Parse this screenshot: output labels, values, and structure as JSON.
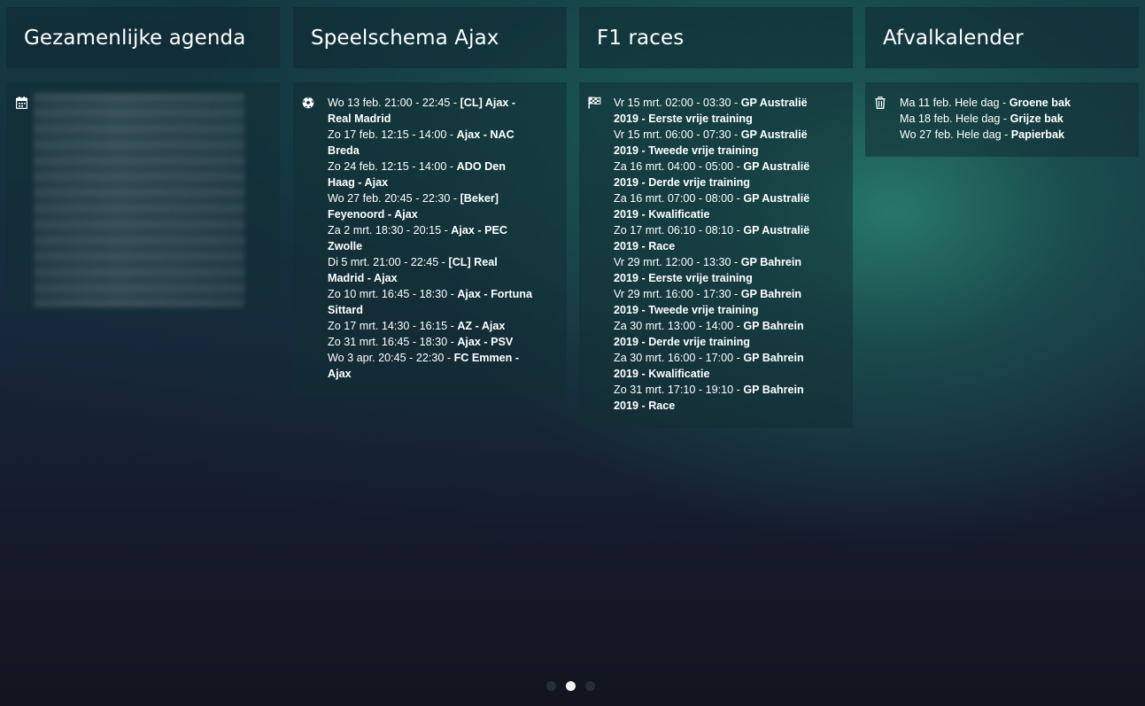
{
  "columns": [
    {
      "title": "Gezamenlijke agenda",
      "icon": "calendar-icon",
      "content": "blurred",
      "events": []
    },
    {
      "title": "Speelschema Ajax",
      "icon": "soccer-ball-icon",
      "events": [
        {
          "time": "Wo 13 feb. 21:00 - 22:45 - ",
          "title": "[CL] Ajax - Real Madrid"
        },
        {
          "time": "Zo 17 feb. 12:15 - 14:00 - ",
          "title": "Ajax - NAC Breda"
        },
        {
          "time": "Zo 24 feb. 12:15 - 14:00 - ",
          "title": "ADO Den Haag - Ajax"
        },
        {
          "time": "Wo 27 feb. 20:45 - 22:30 - ",
          "title": "[Beker] Feyenoord - Ajax"
        },
        {
          "time": "Za 2 mrt. 18:30 - 20:15 - ",
          "title": "Ajax - PEC Zwolle"
        },
        {
          "time": "Di 5 mrt. 21:00 - 22:45 - ",
          "title": "[CL] Real Madrid - Ajax"
        },
        {
          "time": "Zo 10 mrt. 16:45 - 18:30 - ",
          "title": "Ajax - Fortuna Sittard"
        },
        {
          "time": "Zo 17 mrt. 14:30 - 16:15 - ",
          "title": "AZ - Ajax"
        },
        {
          "time": "Zo 31 mrt. 16:45 - 18:30 - ",
          "title": "Ajax - PSV"
        },
        {
          "time": "Wo 3 apr. 20:45 - 22:30 - ",
          "title": "FC Emmen - Ajax"
        }
      ]
    },
    {
      "title": "F1 races",
      "icon": "checkered-flag-icon",
      "events": [
        {
          "time": "Vr 15 mrt. 02:00 - 03:30 - ",
          "title": "GP Australië 2019 - Eerste vrije training"
        },
        {
          "time": "Vr 15 mrt. 06:00 - 07:30 - ",
          "title": "GP Australië 2019 - Tweede vrije training"
        },
        {
          "time": "Za 16 mrt. 04:00 - 05:00 - ",
          "title": "GP Australië 2019 - Derde vrije training"
        },
        {
          "time": "Za 16 mrt. 07:00 - 08:00 - ",
          "title": "GP Australië 2019 - Kwalificatie"
        },
        {
          "time": "Zo 17 mrt. 06:10 - 08:10 - ",
          "title": "GP Australië 2019 - Race"
        },
        {
          "time": "Vr 29 mrt. 12:00 - 13:30 - ",
          "title": "GP Bahrein 2019 - Eerste vrije training"
        },
        {
          "time": "Vr 29 mrt. 16:00 - 17:30 - ",
          "title": "GP Bahrein 2019 - Tweede vrije training"
        },
        {
          "time": "Za 30 mrt. 13:00 - 14:00 - ",
          "title": "GP Bahrein 2019 - Derde vrije training"
        },
        {
          "time": "Za 30 mrt. 16:00 - 17:00 - ",
          "title": "GP Bahrein 2019 - Kwalificatie"
        },
        {
          "time": "Zo 31 mrt. 17:10 - 19:10 - ",
          "title": "GP Bahrein 2019 - Race"
        }
      ]
    },
    {
      "title": "Afvalkalender",
      "icon": "trash-icon",
      "events": [
        {
          "time": "Ma 11 feb. Hele dag - ",
          "title": "Groene bak"
        },
        {
          "time": "Ma 18 feb. Hele dag - ",
          "title": "Grijze bak"
        },
        {
          "time": "Wo 27 feb. Hele dag - ",
          "title": "Papierbak"
        }
      ]
    }
  ],
  "pager": {
    "pages": 3,
    "active_index": 1
  },
  "colors": {
    "text": "#ffffff",
    "dot_active": "#f2f2f2",
    "dot_inactive": "#28323c"
  }
}
